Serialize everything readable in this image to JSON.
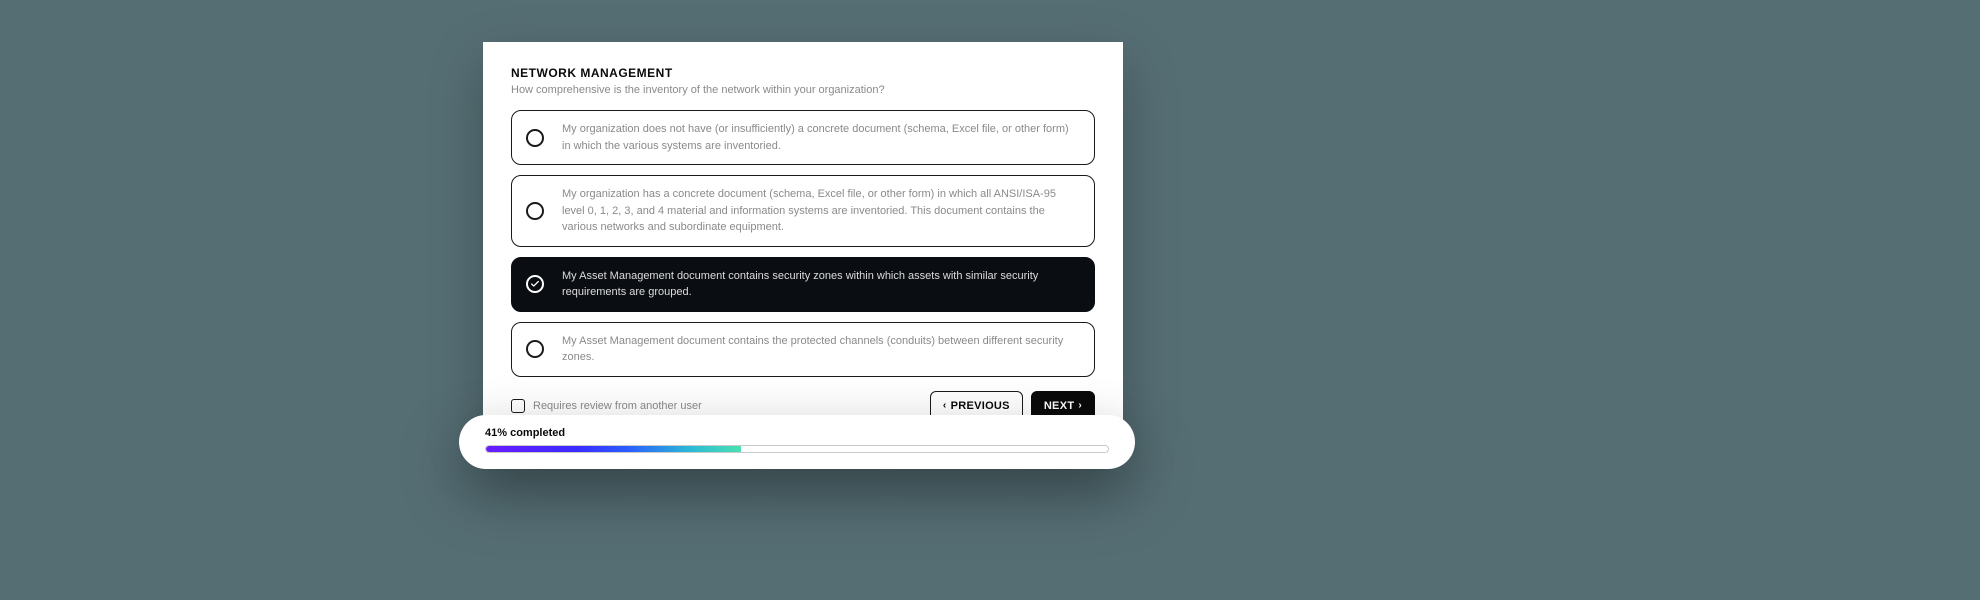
{
  "section": {
    "title": "NETWORK MANAGEMENT",
    "subtitle": "How comprehensive is the inventory of the network within your organization?"
  },
  "options": [
    {
      "text": "My organization does not have (or insufficiently) a concrete document (schema, Excel file, or other form) in which the various systems are inventoried.",
      "selected": false
    },
    {
      "text": "My organization has a concrete document (schema, Excel file, or other form) in which all ANSI/ISA-95 level 0, 1, 2, 3, and 4 material and information systems are inventoried. This document contains the various networks and subordinate equipment.",
      "selected": false
    },
    {
      "text": "My Asset Management document contains security zones within which assets with similar security requirements are grouped.",
      "selected": true
    },
    {
      "text": "My Asset Management document contains the protected channels (conduits) between different security zones.",
      "selected": false
    }
  ],
  "review": {
    "label": "Requires review from another user",
    "checked": false
  },
  "nav": {
    "previous": "PREVIOUS",
    "next": "NEXT"
  },
  "progress": {
    "label": "41% completed",
    "percent": 41
  }
}
